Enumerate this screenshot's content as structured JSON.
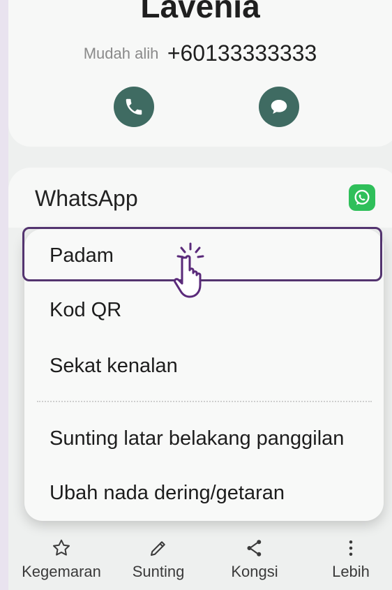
{
  "contact": {
    "name": "Lavenia",
    "phone_label": "Mudah alih",
    "phone_number": "+60133333333"
  },
  "actions": [
    {
      "icon": "phone-icon"
    },
    {
      "icon": "message-icon"
    }
  ],
  "app_section": {
    "label": "WhatsApp",
    "icon": "whatsapp-icon",
    "icon_color": "#2fbf5a"
  },
  "menu": {
    "items": [
      {
        "label": "Padam"
      },
      {
        "label": "Kod QR"
      },
      {
        "label": "Sekat kenalan"
      },
      {
        "label": "Sunting latar belakang panggilan"
      },
      {
        "label": "Ubah nada dering/getaran"
      }
    ],
    "highlighted_item": "Padam",
    "highlight_color": "#53346f"
  },
  "bottom_bar": {
    "items": [
      {
        "label": "Kegemaran",
        "icon": "star-icon"
      },
      {
        "label": "Sunting",
        "icon": "pencil-icon"
      },
      {
        "label": "Kongsi",
        "icon": "share-icon"
      },
      {
        "label": "Lebih",
        "icon": "more-vertical-icon"
      }
    ]
  },
  "colors": {
    "accent": "#3f6b62",
    "background": "#eef0ef"
  }
}
